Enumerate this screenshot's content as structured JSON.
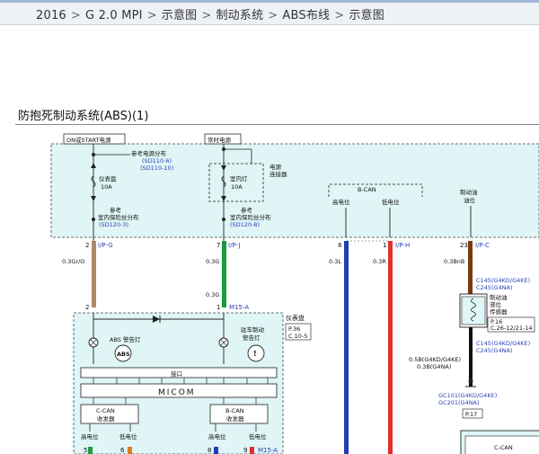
{
  "breadcrumb": [
    "2016",
    "G 2.0 MPI",
    "示意图",
    "制动系统",
    "ABS布线",
    "示意图"
  ],
  "breadcrumb_separator": ">",
  "page_title": "防抱死制动系统(ABS)(1)",
  "diagram": {
    "power_box_left": "ON或START电源",
    "power_box_right": "常时电源",
    "ref_power_dist": "参考电源分布",
    "ref_power_codes": [
      "(SD110-6)",
      "(SD110-10)"
    ],
    "fuse_left": [
      "仪表盘",
      "10A"
    ],
    "fuse_right": [
      "室内灯",
      "10A"
    ],
    "power_connector": [
      "电源",
      "连接器"
    ],
    "ref_fuse_title": [
      "参考",
      "室内保险丝分布"
    ],
    "ref_fuse_left_code": "(SD120-3)",
    "ref_fuse_right_code": "(SD120-8)",
    "bcan": "B-CAN",
    "bcan_high": "高电位",
    "bcan_low": "低电位",
    "brake_fluid": [
      "制动油",
      "油位"
    ],
    "pin_left": "2",
    "pin_left_conn": "I/P-G",
    "pin_mid": "7",
    "pin_mid_conn": "I/P-J",
    "pin_8": "8",
    "pin_1": "1",
    "pin_1_conn": "I/P-H",
    "pin_23": "23",
    "pin_23_conn": "I/P-C",
    "wire_left": "0.3Gr/O",
    "wire_mid_1": "0.3G",
    "wire_mid_2": "0.3G",
    "wire_8": "0.3L",
    "wire_1": "0.3R",
    "wire_23": "0.3BnB",
    "c145_top": "C145(G4KD/G4KE)",
    "c245_top": "C245(G4NA)",
    "sensor_label": [
      "制动油",
      "液位",
      "传感器"
    ],
    "sensor_ref": [
      "P.16",
      "C.26-12/21-14"
    ],
    "c145_bottom": "C145(G4KD/G4KE)",
    "c245_bottom": "C245(G4NA)",
    "wire_bottom": [
      "0.5B(G4KD/G4KE)",
      "0.3B(G4NA)"
    ],
    "gc101": "GC101(G4KD/G4KE)",
    "gc201": "GC201(G4NA)",
    "ground_ref": "P.17",
    "cluster_pin_left": "2",
    "cluster_pin_right": "1",
    "cluster_conn": "M15-A",
    "cluster_label": "仪表盘",
    "cluster_ref": [
      "P.36",
      "C.10-5"
    ],
    "abs_warning": "ABS 警告灯",
    "abs_badge": "ABS",
    "park_warning": [
      "驻车制动",
      "警告灯"
    ],
    "interface": "接口",
    "micom": "MICOM",
    "ccan_box": [
      "C-CAN",
      "收发器"
    ],
    "bcan_box": [
      "B-CAN",
      "收发器"
    ],
    "bottom_high_1": "高电位",
    "bottom_low_1": "低电位",
    "bottom_high_2": "高电位",
    "bottom_low_2": "低电位",
    "bottom_pins": [
      "5",
      "6",
      "8",
      "9"
    ],
    "bottom_conn": "M15-A",
    "ccan_right": "C-CAN"
  },
  "colors": {
    "wire_left": "#b08a66",
    "wire_green": "#1a9c3a",
    "wire_blue": "#1f3fb5",
    "wire_red": "#e03030",
    "wire_brown": "#7a3a10",
    "orange": "#e07a1a",
    "link": "#2e3fb8",
    "box_fill": "#dff5f6"
  }
}
